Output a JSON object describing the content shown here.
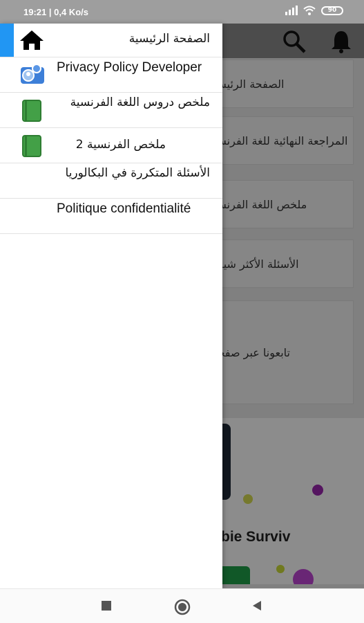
{
  "status": {
    "time": "19:21",
    "speed": "0,4 Ko/s",
    "battery": "90"
  },
  "background": {
    "cards": [
      "الصفحة الرئيسية",
      "المراجعة النهائية للغة الفرنسية",
      "ملخص اللغة الفرنسية",
      "الأسئلة الأكثر شيوعا",
      "تابعونا عبر صفحتنا"
    ],
    "ad_title": "bie Surviv"
  },
  "drawer": {
    "items": [
      {
        "label": "الصفحة الرئيسية",
        "icon": "home-icon"
      },
      {
        "label": "Privacy Policy Developer",
        "icon": "contacts-icon"
      },
      {
        "label": "ملخص دروس اللغة الفرنسية",
        "icon": "book-icon"
      },
      {
        "label": "ملخص الفرنسية 2",
        "icon": "book-icon"
      },
      {
        "label": "الأسئلة المتكررة في البكالوريا",
        "icon": ""
      },
      {
        "label": "Politique confidentialité",
        "icon": ""
      }
    ]
  },
  "colors": {
    "accent": "#2196f3",
    "book": "#43a047",
    "scrim": "#000000"
  }
}
